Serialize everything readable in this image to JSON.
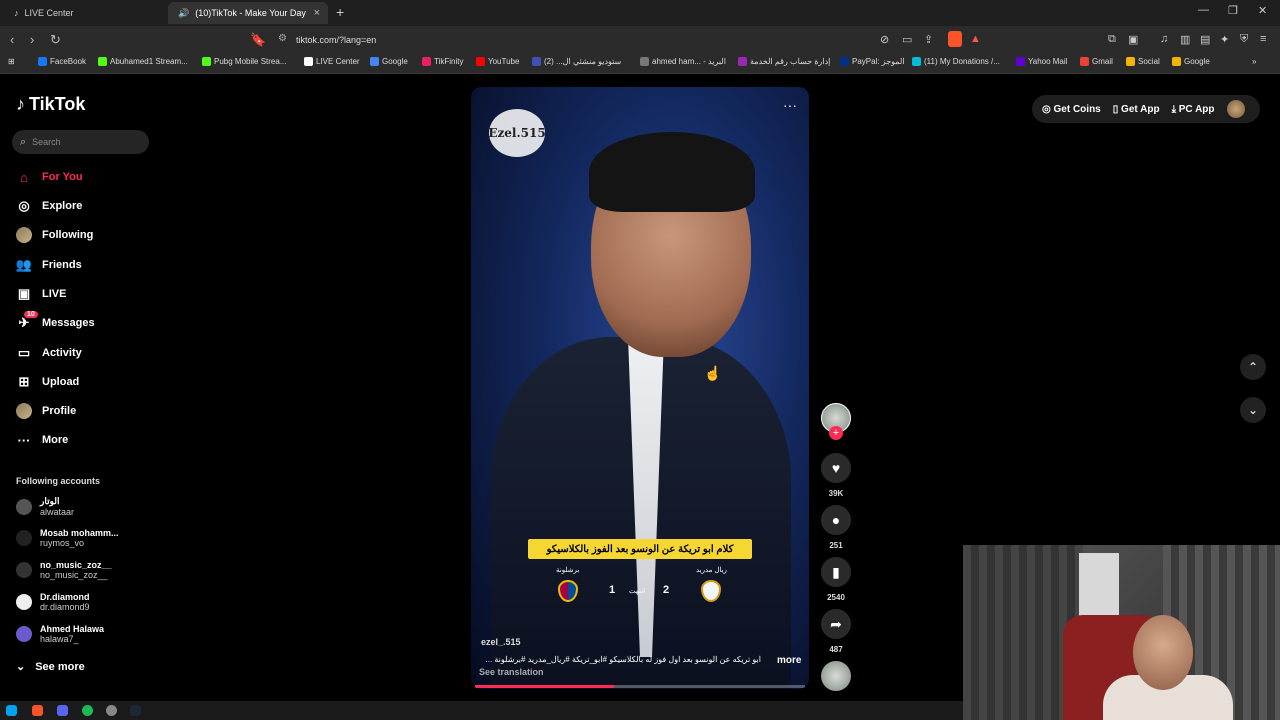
{
  "browser": {
    "tabs": [
      {
        "label": "LIVE Center"
      },
      {
        "label": "(10)TikTok - Make Your Day"
      }
    ],
    "url": "tiktok.com/?lang=en",
    "bookmarks": [
      {
        "label": "FaceBook",
        "color": "#1877f2"
      },
      {
        "label": "Abuhamed1 Stream...",
        "color": "#53fc18"
      },
      {
        "label": "Pubg Mobile Strea...",
        "color": "#53fc18"
      },
      {
        "label": "LIVE Center",
        "color": "#ffffff"
      },
      {
        "label": "Google",
        "color": "#4285f4"
      },
      {
        "label": "TikFinity",
        "color": "#e91e63"
      },
      {
        "label": "YouTube",
        "color": "#ff0000"
      },
      {
        "label": "ستوديو منشئي ال... (2)",
        "color": "#3f51b5"
      },
      {
        "label": "ahmed ham... - البريد",
        "color": "#777777"
      },
      {
        "label": "إدارة حساب رقم الخدمة",
        "color": "#9c27b0"
      },
      {
        "label": "PayPal: الموجز",
        "color": "#003087"
      },
      {
        "label": "(11) My Donations /...",
        "color": "#00bcd4"
      },
      {
        "label": "Yahoo Mail",
        "color": "#6001d2"
      },
      {
        "label": "Gmail",
        "color": "#ea4335"
      },
      {
        "label": "Social",
        "color": "#f4b400"
      },
      {
        "label": "Google",
        "color": "#f4b400"
      }
    ]
  },
  "tiktok": {
    "logo": "TikTok",
    "search_placeholder": "Search",
    "nav": [
      {
        "label": "For You",
        "icon": "home-icon"
      },
      {
        "label": "Explore",
        "icon": "compass-icon"
      },
      {
        "label": "Following",
        "icon": "following-avatar"
      },
      {
        "label": "Friends",
        "icon": "friends-icon"
      },
      {
        "label": "LIVE",
        "icon": "live-icon"
      },
      {
        "label": "Messages",
        "icon": "messages-icon",
        "badge": "10"
      },
      {
        "label": "Activity",
        "icon": "activity-icon"
      },
      {
        "label": "Upload",
        "icon": "upload-icon"
      },
      {
        "label": "Profile",
        "icon": "profile-avatar"
      },
      {
        "label": "More",
        "icon": "more-icon"
      }
    ],
    "following_title": "Following accounts",
    "following": [
      {
        "name": "الوتار",
        "handle": "alwataar"
      },
      {
        "name": "Mosab mohamm...",
        "handle": "ruymos_vo"
      },
      {
        "name": "no_music_zoz__",
        "handle": "no_music_zoz__"
      },
      {
        "name": "Dr.diamond",
        "handle": "dr.diamond9"
      },
      {
        "name": "Ahmed Halawa",
        "handle": "halawa7_"
      }
    ],
    "see_more": "See more",
    "top_right": {
      "get_coins": "Get Coins",
      "get_app": "Get App",
      "pc_app": "PC App"
    },
    "video": {
      "watermark": "Ezel.515",
      "caption": "كلام ابو تريكة عن الونسو بعد الفوز بالكلاسيكو",
      "scoreboard": {
        "home_team": "ريال مدريد",
        "away_team": "برشلونة",
        "home_score": "2",
        "away_score": "1",
        "status": "انتهت"
      },
      "author": "ezel_.515",
      "description": "ابو تريكه عن الونسو بعد اول فوز له بالكلاسيكو #ابو_تريكة #ريال_مدريد #برشلونة ...",
      "more": "more",
      "see_translation": "See translation",
      "progress": 0.42
    },
    "actions": {
      "likes": "39K",
      "comments": "251",
      "saves": "2540",
      "shares": "487"
    }
  }
}
